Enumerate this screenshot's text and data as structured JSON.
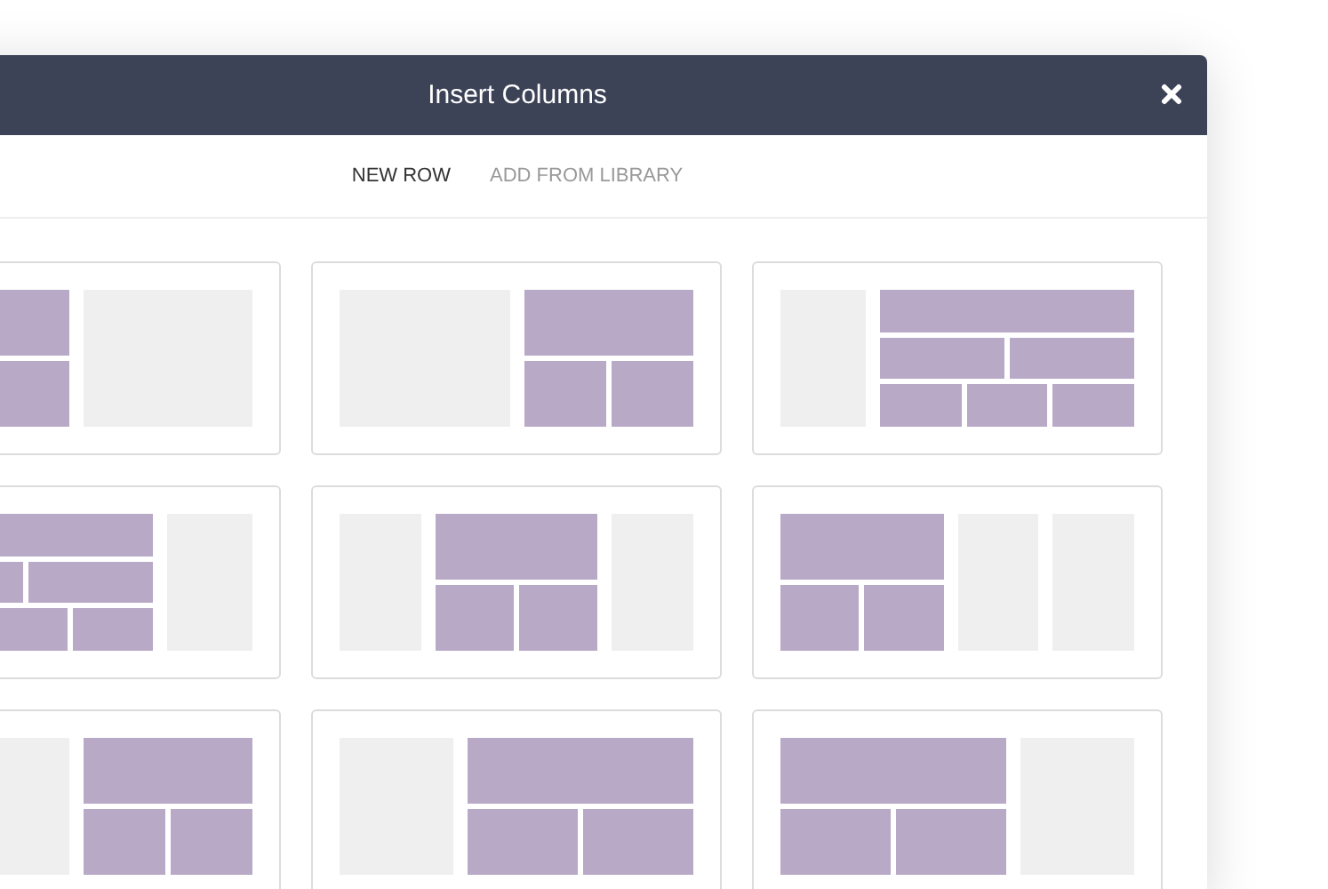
{
  "window": {
    "title": "Insert Columns"
  },
  "tabs": [
    {
      "label": "NEW ROW",
      "selected": true
    },
    {
      "label": "ADD FROM LIBRARY",
      "selected": false
    }
  ],
  "layouts": [
    {
      "kind": "left-half"
    },
    {
      "kind": "right-half"
    },
    {
      "kind": "right-three-quarter"
    },
    {
      "kind": "left-three-quarter"
    },
    {
      "kind": "center-half"
    },
    {
      "kind": "left-half-two-quarters"
    },
    {
      "kind": "right-half"
    },
    {
      "kind": "right-two-thirds"
    },
    {
      "kind": "left-two-thirds"
    }
  ]
}
